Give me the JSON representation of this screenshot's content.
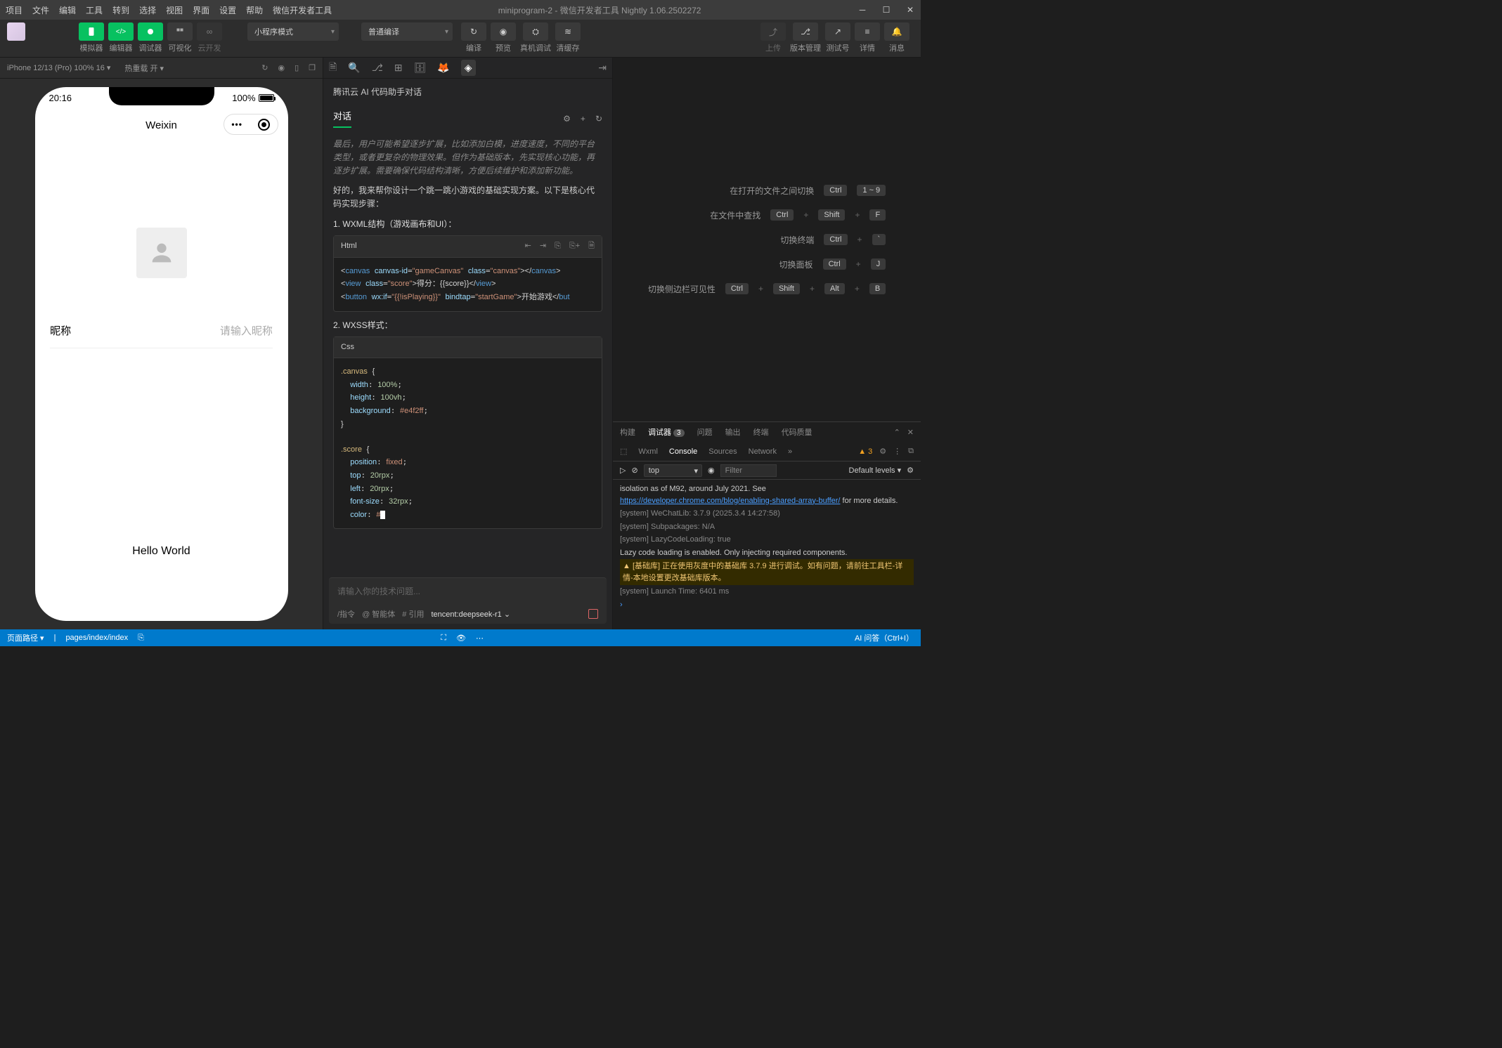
{
  "titlebar": {
    "menus": [
      "项目",
      "文件",
      "编辑",
      "工具",
      "转到",
      "选择",
      "视图",
      "界面",
      "设置",
      "帮助",
      "微信开发者工具"
    ],
    "title": "miniprogram-2 - 微信开发者工具 Nightly 1.06.2502272"
  },
  "toolbar": {
    "groups": [
      {
        "label": "模拟器",
        "kind": "green"
      },
      {
        "label": "编辑器",
        "kind": "green"
      },
      {
        "label": "调试器",
        "kind": "green"
      },
      {
        "label": "可视化",
        "kind": "grey"
      },
      {
        "label": "云开发",
        "kind": "grey-dim"
      }
    ],
    "mode_dd": "小程序模式",
    "compile_dd": "普通编译",
    "actions": [
      "编译",
      "预览",
      "真机调试",
      "清缓存"
    ],
    "right_actions": [
      "上传",
      "版本管理",
      "测试号",
      "详情",
      "消息"
    ]
  },
  "sim": {
    "device": "iPhone 12/13 (Pro) 100% 16 ▾",
    "reload": "热重载 开 ▾",
    "phone": {
      "time": "20:16",
      "battery": "100%",
      "nav_title": "Weixin",
      "avatar_alt": "avatar",
      "nick_label": "昵称",
      "nick_placeholder": "请输入昵称",
      "hello": "Hello World"
    }
  },
  "ai": {
    "title": "腾讯云 AI 代码助手对话",
    "tab": "对话",
    "preamble": "最后，用户可能希望逐步扩展，比如添加白模，进度速度，不同的平台类型，或者更复杂的物理效果。但作为基础版本，先实现核心功能，再逐步扩展。需要确保代码结构清晰，方便后续维护和添加新功能。",
    "intro": "好的，我来帮你设计一个跳一跳小游戏的基础实现方案。以下是核心代码实现步骤：",
    "sec1": "1. WXML结构（游戏画布和UI）：",
    "code1_lang": "Html",
    "code1": "<canvas canvas-id=\"gameCanvas\" class=\"canvas\"></canvas>\n<view class=\"score\">得分：{{score}}</view>\n<button wx:if=\"{{!isPlaying}}\" bindtap=\"startGame\">开始游戏</button>",
    "sec2": "2. WXSS样式：",
    "code2_lang": "Css",
    "code2": ".canvas {\n  width: 100%;\n  height: 100vh;\n  background: #e4f2ff;\n}\n\n.score {\n  position: fixed;\n  top: 20rpx;\n  left: 20rpx;\n  font-size: 32rpx;\n  color: #",
    "input_placeholder": "请输入你的技术问题...",
    "input_bar": {
      "cmd": "/指令",
      "agent": "@ 智能体",
      "ref": "# 引用",
      "model": "tencent:deepseek-r1"
    }
  },
  "shortcuts": [
    {
      "label": "在打开的文件之间切换",
      "keys": [
        "Ctrl",
        "1 ~ 9"
      ]
    },
    {
      "label": "在文件中查找",
      "keys": [
        "Ctrl",
        "+",
        "Shift",
        "+",
        "F"
      ]
    },
    {
      "label": "切换终端",
      "keys": [
        "Ctrl",
        "+",
        "`"
      ]
    },
    {
      "label": "切换面板",
      "keys": [
        "Ctrl",
        "+",
        "J"
      ]
    },
    {
      "label": "切换侧边栏可见性",
      "keys": [
        "Ctrl",
        "+",
        "Shift",
        "+",
        "Alt",
        "+",
        "B"
      ]
    }
  ],
  "panel": {
    "tabs": [
      "构建",
      "调试器",
      "问题",
      "输出",
      "终端",
      "代码质量"
    ],
    "tabs_active": "调试器",
    "debugger_badge": "3",
    "dt_tabs": [
      "Wxml",
      "Console",
      "Sources",
      "Network"
    ],
    "dt_active": "Console",
    "dt_more": "»",
    "warn_count": "3",
    "context": "top",
    "filter_ph": "Filter",
    "levels": "Default levels ▾",
    "lines": [
      {
        "t": "plain",
        "txt": "isolation as of M92, around July 2021. See ",
        "link": "https://developer.chrome.com/blog/enabling-shared-array-buffer/",
        "tail": " for more details."
      },
      {
        "t": "sys",
        "txt": "[system] WeChatLib: 3.7.9 (2025.3.4 14:27:58)"
      },
      {
        "t": "sys",
        "txt": "[system] Subpackages: N/A"
      },
      {
        "t": "sys",
        "txt": "[system] LazyCodeLoading: true"
      },
      {
        "t": "plain2",
        "txt": "Lazy code loading is enabled. Only injecting required components."
      },
      {
        "t": "warn",
        "txt": "▲ [基础库] 正在使用灰度中的基础库 3.7.9 进行调试。如有问题，请前往工具栏-详情-本地设置更改基础库版本。"
      },
      {
        "t": "sys",
        "txt": "[system] Launch Time: 6401 ms"
      }
    ]
  },
  "statusbar": {
    "left": [
      "页面路径 ▾",
      "pages/index/index"
    ],
    "right": [
      "AI 问答（Ctrl+I）"
    ]
  }
}
